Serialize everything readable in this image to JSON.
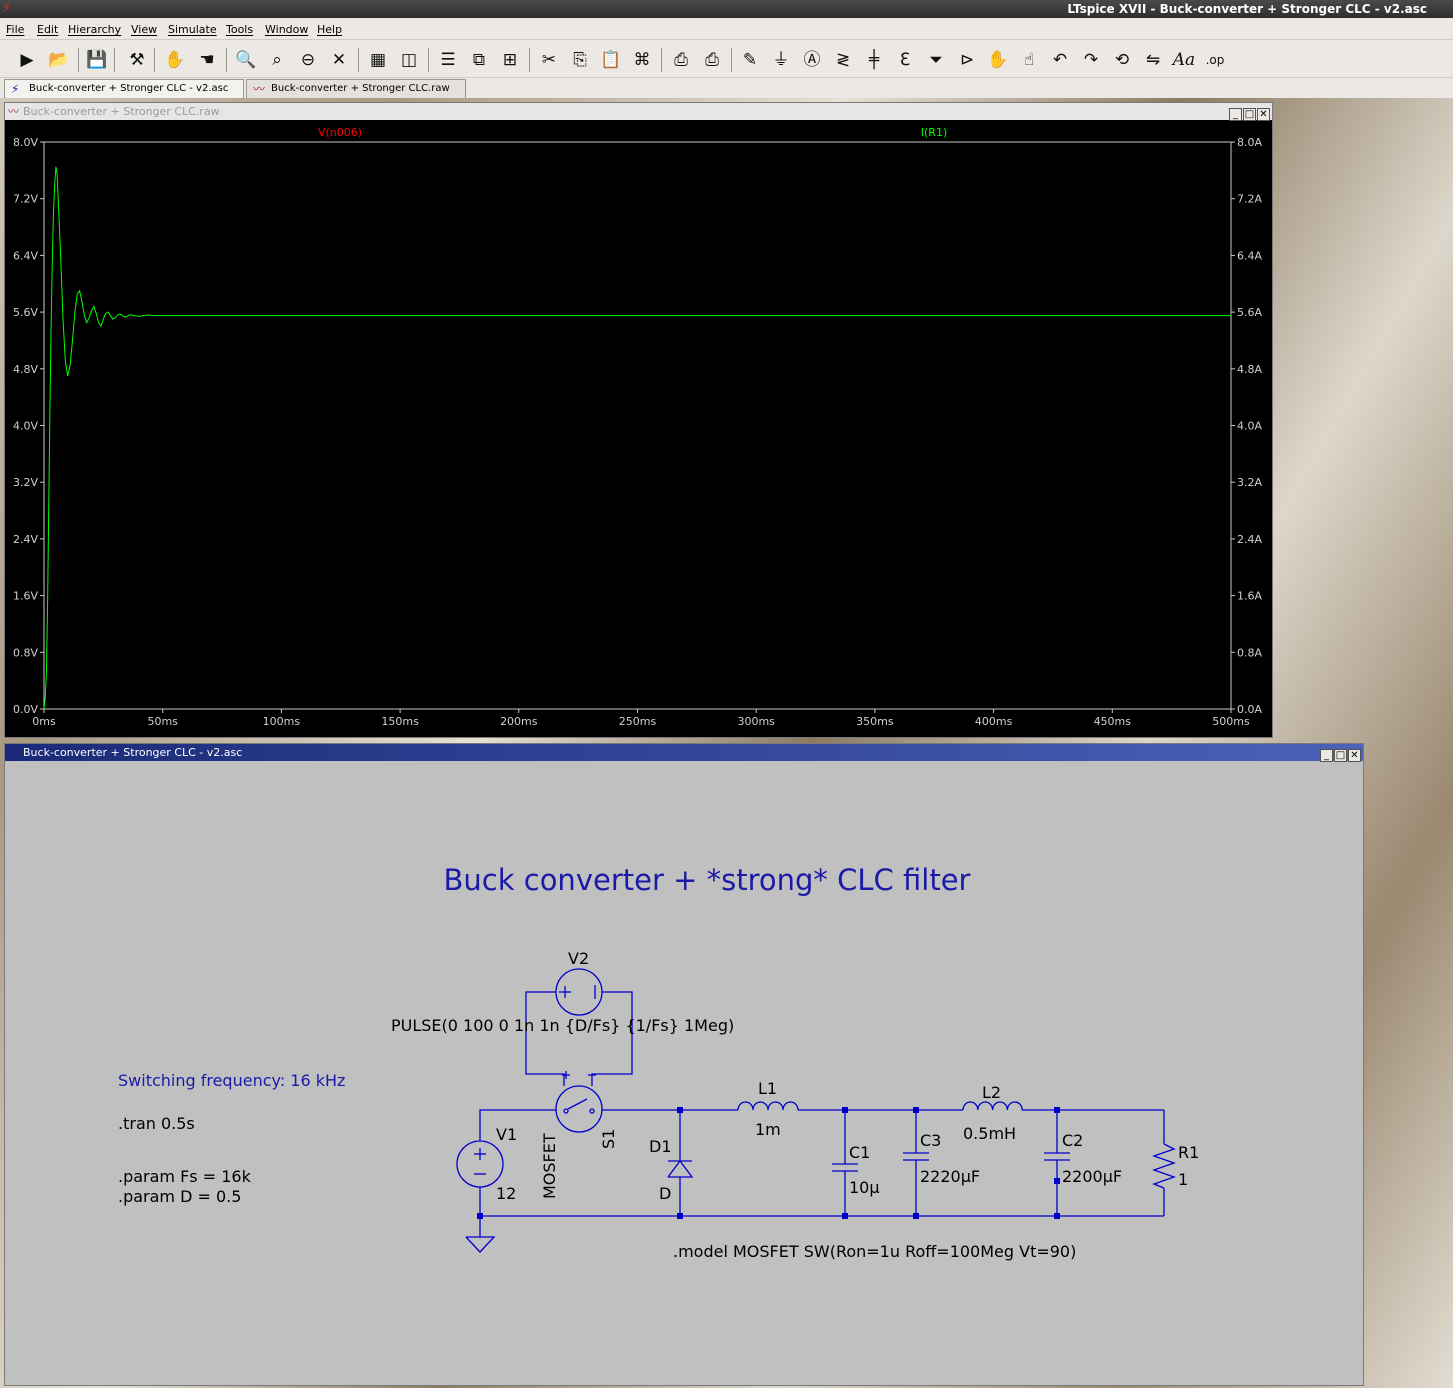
{
  "app": {
    "title": "LTspice XVII - Buck-converter +  Stronger CLC - v2.asc"
  },
  "menu": [
    "File",
    "Edit",
    "Hierarchy",
    "View",
    "Simulate",
    "Tools",
    "Window",
    "Help"
  ],
  "toolbar_icons": [
    "run-icon",
    "open-icon",
    "save-icon",
    "control-panel-icon",
    "halt-icon",
    "pan-hand-icon",
    "zoom-in-icon",
    "zoom-full-icon",
    "zoom-out-icon",
    "zoom-cancel-icon",
    "autorange-icon",
    "pick-visible-icon",
    "tile-horizontal-icon",
    "cascade-icon",
    "tile-vertical-icon",
    "cut-icon",
    "copy-icon",
    "paste-icon",
    "find-icon",
    "print-icon",
    "print-setup-icon",
    "draw-wire-icon",
    "ground-icon",
    "label-net-icon",
    "resistor-icon",
    "capacitor-icon",
    "inductor-icon",
    "diode-icon",
    "component-icon",
    "move-icon",
    "drag-icon",
    "undo-icon",
    "redo-icon",
    "rotate-icon",
    "mirror-icon",
    "text-icon",
    "spice-directive-icon"
  ],
  "tabs": [
    {
      "label": "Buck-converter +  Stronger CLC - v2.asc",
      "icon": "schematic-icon"
    },
    {
      "label": "Buck-converter +  Stronger CLC.raw",
      "icon": "waveform-icon"
    }
  ],
  "plot_window": {
    "title": "Buck-converter +  Stronger CLC.raw"
  },
  "schematic_window": {
    "title": "Buck-converter +  Stronger CLC - v2.asc"
  },
  "chart_data": {
    "type": "line",
    "series": [
      {
        "name": "V(n006)",
        "color": "#ff0000",
        "axis": "left"
      },
      {
        "name": "I(R1)",
        "color": "#00ff00",
        "axis": "right",
        "x": [
          0,
          0.5,
          1,
          1.5,
          2,
          2.5,
          3,
          3.5,
          4,
          4.5,
          5,
          5.5,
          6,
          7,
          8,
          9,
          10,
          11,
          12,
          13,
          14,
          15,
          16,
          17,
          18,
          19,
          20,
          21,
          22,
          23,
          24,
          25,
          26,
          27,
          28,
          29,
          30,
          31,
          32,
          33,
          34,
          35,
          36,
          37,
          38,
          40,
          42,
          44,
          46,
          48,
          50,
          52,
          55,
          60,
          80,
          100,
          150,
          200,
          250,
          300,
          350,
          400,
          450,
          500
        ],
        "y": [
          0,
          0.15,
          0.5,
          1.5,
          2.8,
          4.2,
          5.4,
          6.3,
          7.0,
          7.4,
          7.65,
          7.55,
          7.2,
          6.4,
          5.5,
          4.9,
          4.7,
          4.85,
          5.2,
          5.6,
          5.85,
          5.9,
          5.75,
          5.55,
          5.45,
          5.52,
          5.62,
          5.68,
          5.58,
          5.45,
          5.4,
          5.5,
          5.58,
          5.6,
          5.55,
          5.5,
          5.52,
          5.56,
          5.57,
          5.55,
          5.53,
          5.54,
          5.56,
          5.56,
          5.55,
          5.54,
          5.55,
          5.56,
          5.55,
          5.55,
          5.55,
          5.55,
          5.55,
          5.55,
          5.55,
          5.55,
          5.55,
          5.55,
          5.55,
          5.55,
          5.55,
          5.55,
          5.55,
          5.55
        ]
      }
    ],
    "x_ticks": [
      "0ms",
      "50ms",
      "100ms",
      "150ms",
      "200ms",
      "250ms",
      "300ms",
      "350ms",
      "400ms",
      "450ms",
      "500ms"
    ],
    "left_ticks": [
      "0.0V",
      "0.8V",
      "1.6V",
      "2.4V",
      "3.2V",
      "4.0V",
      "4.8V",
      "5.6V",
      "6.4V",
      "7.2V",
      "8.0V"
    ],
    "right_ticks": [
      "0.0A",
      "0.8A",
      "1.6A",
      "2.4A",
      "3.2A",
      "4.0A",
      "4.8A",
      "5.6A",
      "6.4A",
      "7.2A",
      "8.0A"
    ],
    "xlim": [
      0,
      500
    ],
    "ylim": [
      0,
      8
    ],
    "grid": false,
    "background": "#000000"
  },
  "schematic": {
    "title": "Buck converter + *strong* CLC filter",
    "switching_freq": "Switching frequency: 16 kHz",
    "tran": ".tran 0.5s",
    "param_fs": ".param Fs = 16k",
    "param_d": ".param D = 0.5",
    "model": ".model MOSFET SW(Ron=1u Roff=100Meg Vt=90)",
    "pulse": "PULSE(0 100 0 1n 1n {D/Fs} {1/Fs} 1Meg)",
    "v2": {
      "ref": "V2"
    },
    "v1": {
      "ref": "V1",
      "value": "12"
    },
    "s1": {
      "ref": "S1",
      "model": "MOSFET"
    },
    "d1": {
      "ref": "D1",
      "value": "D"
    },
    "l1": {
      "ref": "L1",
      "value": "1m"
    },
    "c1": {
      "ref": "C1",
      "value": "10µ"
    },
    "c3": {
      "ref": "C3",
      "value": "2220µF"
    },
    "l2": {
      "ref": "L2",
      "value": "0.5mH"
    },
    "c2": {
      "ref": "C2",
      "value": "2200µF"
    },
    "r1": {
      "ref": "R1",
      "value": "1"
    },
    "colors": {
      "wire": "#0000cc",
      "text_blue": "#1a1aa6",
      "text_black": "#000000",
      "background": "#c0c0c0"
    }
  }
}
